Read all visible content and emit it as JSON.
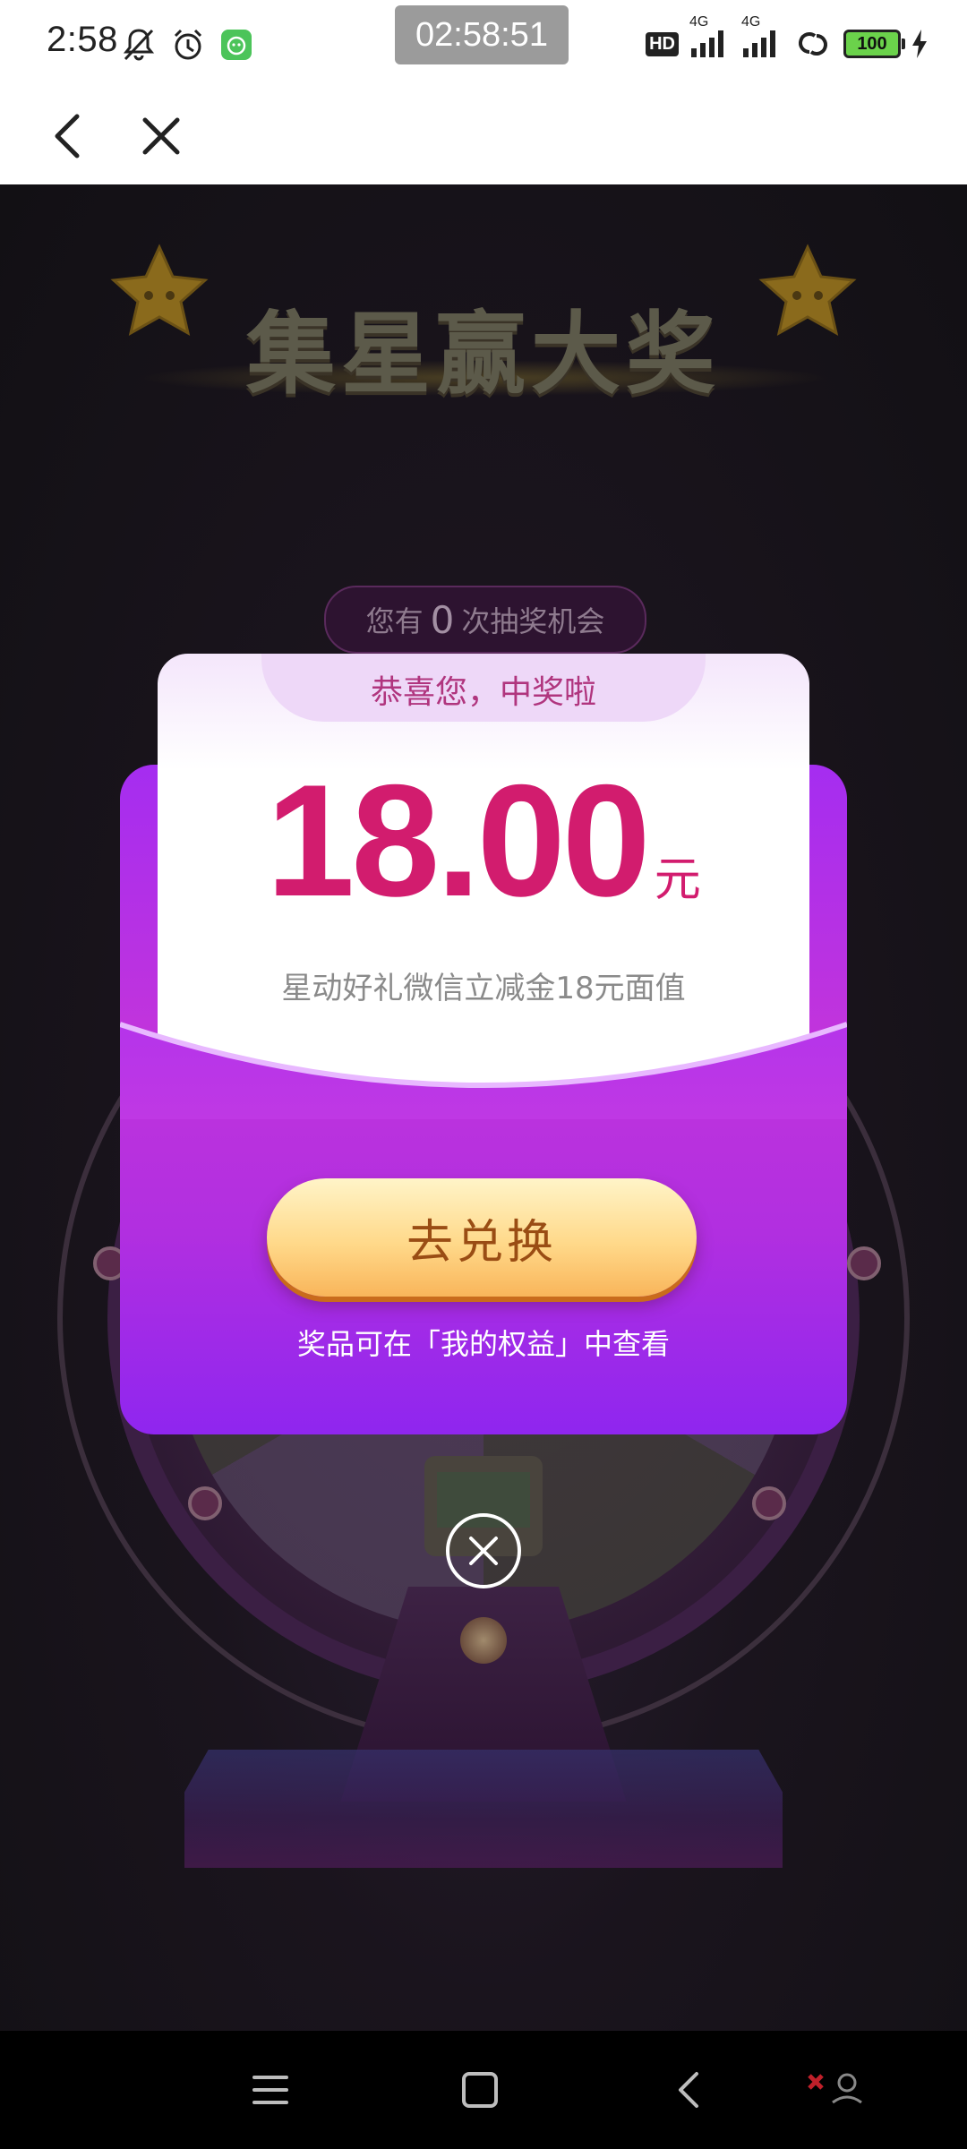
{
  "status_bar": {
    "time": "2:58",
    "clock_pill": "02:58:51",
    "hd": "HD",
    "network_1": "4G",
    "network_2": "4G",
    "battery": "100",
    "icons": [
      "mute-bell-icon",
      "alarm-icon",
      "app-notification-icon",
      "signal-icon",
      "link-icon",
      "charging-icon"
    ]
  },
  "nav": {
    "icons": [
      "back-icon",
      "close-icon"
    ]
  },
  "page": {
    "title": "集星赢大奖",
    "chances_prefix": "您有",
    "chances_count": "0",
    "chances_suffix": "次抽奖机会"
  },
  "modal": {
    "congrats": "恭喜您，中奖啦",
    "amount": "18.00",
    "unit": "元",
    "description": "星动好礼微信立减金18元面值",
    "redeem_label": "去兑换",
    "hint": "奖品可在「我的权益」中查看"
  },
  "colors": {
    "accent_purple": "#a52df0",
    "amount_pink": "#d21c6e",
    "button_gold": "#ffd98a"
  },
  "system_nav": {
    "icons": [
      "menu-icon",
      "home-icon",
      "back-icon"
    ]
  }
}
